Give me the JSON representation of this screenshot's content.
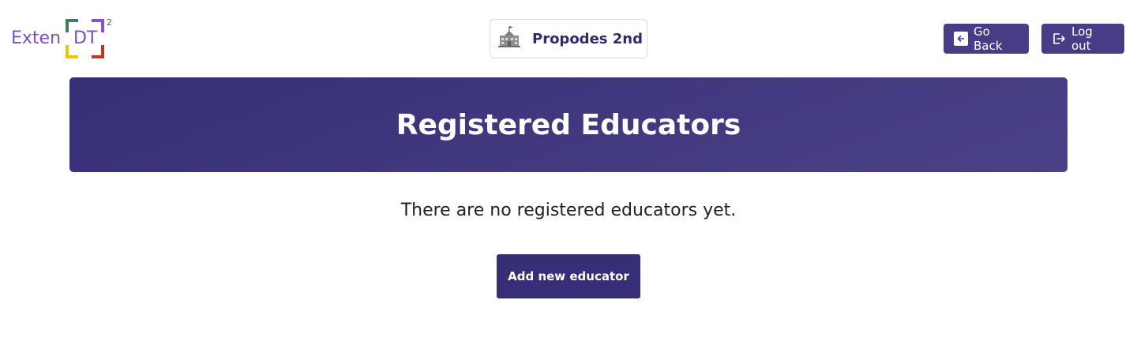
{
  "logo": {
    "text_part1": "Exten",
    "text_part2": "DT",
    "superscript": "2"
  },
  "header": {
    "school_name": "Propodes 2nd",
    "school_icon": "school-building-icon",
    "go_back_label": "Go Back",
    "logout_label": "Log out"
  },
  "banner": {
    "title": "Registered Educators"
  },
  "main": {
    "empty_message": "There are no registered educators yet.",
    "add_button_label": "Add new educator"
  },
  "colors": {
    "primary": "#463d86",
    "banner": "#3c3479",
    "button_dark": "#372e78",
    "logo_purple": "#7a4fc4"
  }
}
